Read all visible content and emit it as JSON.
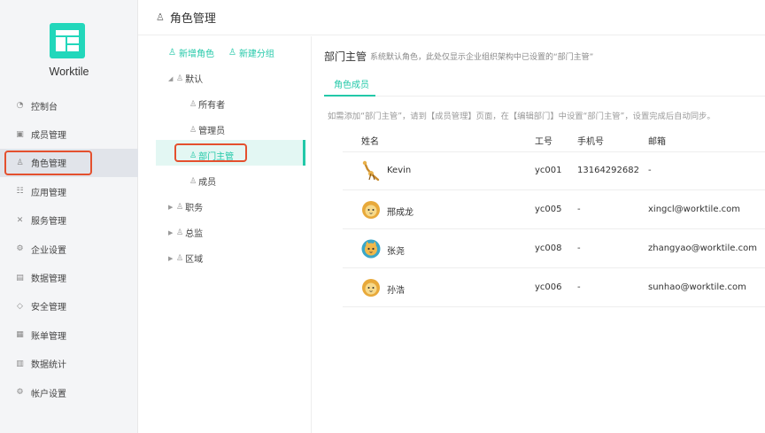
{
  "app": {
    "name": "Worktile",
    "brand_color": "#22d7bb",
    "accent_color": "#22c8a8",
    "highlight_color": "#e4502e"
  },
  "sidebar": {
    "items": [
      {
        "label": "控制台",
        "icon": "dashboard-icon"
      },
      {
        "label": "成员管理",
        "icon": "members-icon"
      },
      {
        "label": "角色管理",
        "icon": "role-icon",
        "active": true
      },
      {
        "label": "应用管理",
        "icon": "apps-icon"
      },
      {
        "label": "服务管理",
        "icon": "services-icon"
      },
      {
        "label": "企业设置",
        "icon": "gear-icon"
      },
      {
        "label": "数据管理",
        "icon": "data-icon"
      },
      {
        "label": "安全管理",
        "icon": "shield-icon"
      },
      {
        "label": "账单管理",
        "icon": "bill-icon"
      },
      {
        "label": "数据统计",
        "icon": "stats-icon"
      },
      {
        "label": "帐户设置",
        "icon": "account-gear-icon"
      }
    ]
  },
  "header": {
    "title": "角色管理"
  },
  "tree": {
    "add_role": "新增角色",
    "add_group": "新建分组",
    "nodes": [
      {
        "label": "默认",
        "expanded": true
      },
      {
        "label": "所有者"
      },
      {
        "label": "管理员"
      },
      {
        "label": "部门主管",
        "selected": true
      },
      {
        "label": "成员"
      },
      {
        "label": "职务",
        "expanded": false
      },
      {
        "label": "总监",
        "expanded": false
      },
      {
        "label": "区域",
        "expanded": false
      }
    ]
  },
  "detail": {
    "title": "部门主管",
    "description": "系统默认角色，此处仅显示企业组织架构中已设置的“部门主管”",
    "tab": "角色成员",
    "hint": "如需添加“部门主管”，请到【成员管理】页面，在【编辑部门】中设置“部门主管”，设置完成后自动同步。",
    "columns": [
      "姓名",
      "工号",
      "手机号",
      "邮箱"
    ],
    "members": [
      {
        "name": "Kevin",
        "no": "yc001",
        "phone": "13164292682",
        "email": "-",
        "avatar": "giraffe-avatar"
      },
      {
        "name": "邢成龙",
        "no": "yc005",
        "phone": "-",
        "email": "xingcl@worktile.com",
        "avatar": "lion-avatar"
      },
      {
        "name": "张尧",
        "no": "yc008",
        "phone": "-",
        "email": "zhangyao@worktile.com",
        "avatar": "cat-avatar"
      },
      {
        "name": "孙浩",
        "no": "yc006",
        "phone": "-",
        "email": "sunhao@worktile.com",
        "avatar": "lion-avatar"
      }
    ]
  }
}
